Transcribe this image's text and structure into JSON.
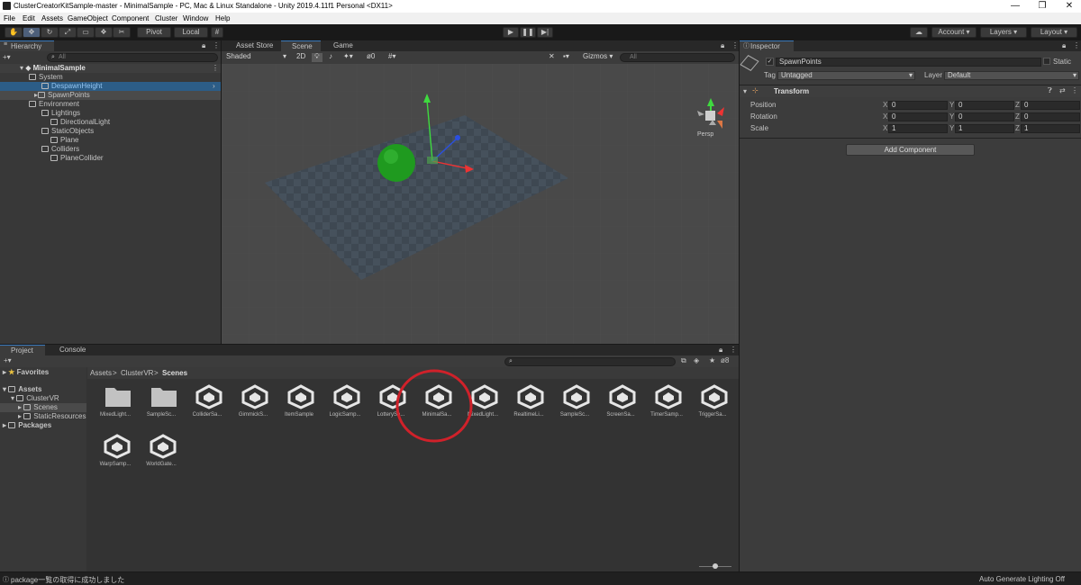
{
  "window": {
    "title": "ClusterCreatorKitSample-master - MinimalSample - PC, Mac & Linux Standalone - Unity 2019.4.11f1 Personal <DX11>",
    "minimize": "—",
    "maximize": "❐",
    "close": "✕"
  },
  "menu": [
    "File",
    "Edit",
    "Assets",
    "GameObject",
    "Component",
    "Cluster",
    "Window",
    "Help"
  ],
  "toolbar": {
    "pivot": "Pivot",
    "local": "Local",
    "account": "Account",
    "layers": "Layers",
    "layout": "Layout"
  },
  "hierarchy": {
    "tab": "Hierarchy",
    "search_placeholder": "All",
    "scene": "MinimalSample",
    "items": [
      {
        "label": "System",
        "depth": 1
      },
      {
        "label": "DespawnHeight",
        "depth": 2
      },
      {
        "label": "SpawnPoints",
        "depth": 2
      },
      {
        "label": "Environment",
        "depth": 1
      },
      {
        "label": "Lightings",
        "depth": 2
      },
      {
        "label": "DirectionalLight",
        "depth": 3
      },
      {
        "label": "StaticObjects",
        "depth": 2
      },
      {
        "label": "Plane",
        "depth": 3
      },
      {
        "label": "Colliders",
        "depth": 2
      },
      {
        "label": "PlaneCollider",
        "depth": 3
      }
    ]
  },
  "scene_tabs": [
    "Asset Store",
    "Scene",
    "Game"
  ],
  "scene": {
    "shading": "Shaded",
    "mode_2d": "2D",
    "hidden_count": "0",
    "gizmos": "Gizmos",
    "search_placeholder": "All",
    "persp": "Persp"
  },
  "inspector": {
    "tab": "Inspector",
    "object_name": "SpawnPoints",
    "static_label": "Static",
    "tag_label": "Tag",
    "tag_value": "Untagged",
    "layer_label": "Layer",
    "layer_value": "Default",
    "component": "Transform",
    "rows": [
      {
        "label": "Position",
        "x": "0",
        "y": "0",
        "z": "0"
      },
      {
        "label": "Rotation",
        "x": "0",
        "y": "0",
        "z": "0"
      },
      {
        "label": "Scale",
        "x": "1",
        "y": "1",
        "z": "1"
      }
    ],
    "add_component": "Add Component"
  },
  "project": {
    "tabs": [
      "Project",
      "Console"
    ],
    "favorites": "Favorites",
    "assets": "Assets",
    "tree": [
      "ClusterVR",
      "Scenes",
      "StaticResources"
    ],
    "packages": "Packages",
    "breadcrumb": [
      "Assets",
      "ClusterVR",
      "Scenes"
    ],
    "hidden_count": "8",
    "items": [
      {
        "label": "MixedLight...",
        "kind": "folder"
      },
      {
        "label": "SampleSc...",
        "kind": "folder"
      },
      {
        "label": "ColliderSa...",
        "kind": "scene"
      },
      {
        "label": "GimmickS...",
        "kind": "scene"
      },
      {
        "label": "ItemSample",
        "kind": "scene"
      },
      {
        "label": "LogicSamp...",
        "kind": "scene"
      },
      {
        "label": "LotterySa...",
        "kind": "scene"
      },
      {
        "label": "MinimalSa...",
        "kind": "scene"
      },
      {
        "label": "MixedLight...",
        "kind": "scene"
      },
      {
        "label": "RealtimeLi...",
        "kind": "scene"
      },
      {
        "label": "SampleSc...",
        "kind": "scene"
      },
      {
        "label": "ScreenSa...",
        "kind": "scene"
      },
      {
        "label": "TimerSamp...",
        "kind": "scene"
      },
      {
        "label": "TriggerSa...",
        "kind": "scene"
      },
      {
        "label": "WarpSamp...",
        "kind": "scene"
      },
      {
        "label": "WorldGate...",
        "kind": "scene"
      }
    ]
  },
  "status": {
    "message": "package一覧の取得に成功しました",
    "right": "Auto Generate Lighting Off"
  },
  "colors": {
    "selection": "#2c5d87",
    "accent_blue": "#3a79bb",
    "highlight_circle": "#d0212a",
    "sphere": "#1f9a1f"
  }
}
